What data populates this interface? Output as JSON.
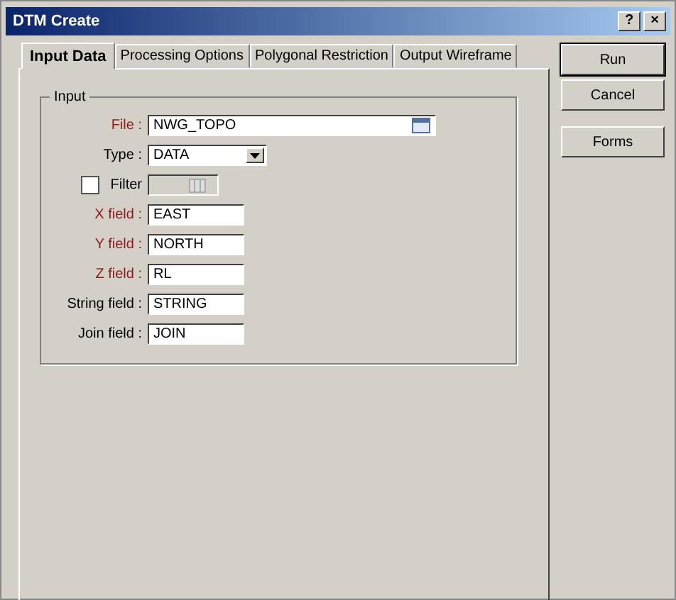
{
  "window": {
    "title": "DTM Create",
    "help": "?",
    "close": "×"
  },
  "tabs": [
    {
      "label": "Input Data",
      "selected": true
    },
    {
      "label": "Processing Options",
      "selected": false
    },
    {
      "label": "Polygonal Restriction",
      "selected": false
    },
    {
      "label": "Output Wireframe",
      "selected": false
    }
  ],
  "group": {
    "title": "Input"
  },
  "fields": [
    {
      "kind": "file",
      "label": "File :",
      "required": true,
      "value": "NWG_TOPO"
    },
    {
      "kind": "dropdown",
      "label": "Type :",
      "required": false,
      "value": "DATA"
    },
    {
      "kind": "filter",
      "label": "Filter",
      "checked": false
    },
    {
      "kind": "text",
      "label": "X field :",
      "required": true,
      "value": "EAST"
    },
    {
      "kind": "text",
      "label": "Y field :",
      "required": true,
      "value": "NORTH"
    },
    {
      "kind": "text",
      "label": "Z field :",
      "required": true,
      "value": "RL"
    },
    {
      "kind": "text",
      "label": "String field :",
      "required": false,
      "value": "STRING"
    },
    {
      "kind": "text",
      "label": "Join field :",
      "required": false,
      "value": "JOIN"
    }
  ],
  "buttons": [
    {
      "label": "Run",
      "default": true
    },
    {
      "label": "Cancel",
      "default": false
    },
    {
      "label": "Forms",
      "default": false
    }
  ]
}
